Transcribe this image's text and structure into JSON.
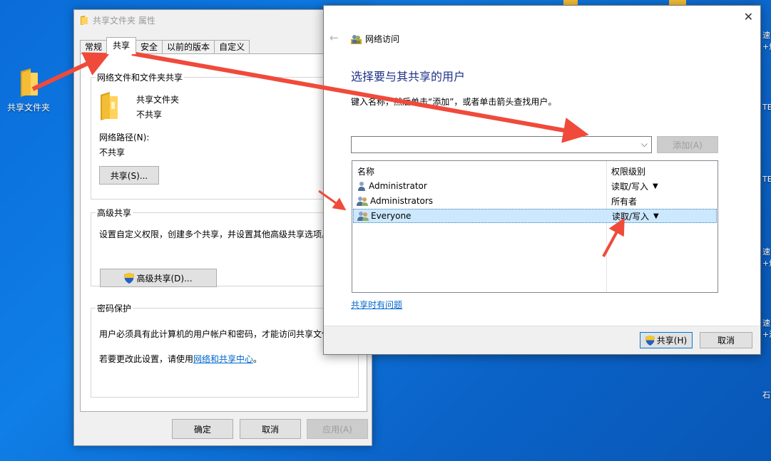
{
  "desktop": {
    "folder_label": "共享文件夹",
    "edge_texts": [
      "速",
      "+炒",
      "TE",
      "TE",
      "速",
      "+炒",
      "速",
      "+淡",
      "石"
    ]
  },
  "props_window": {
    "title": "共享文件夹 属性",
    "tabs": [
      "常规",
      "共享",
      "安全",
      "以前的版本",
      "自定义"
    ],
    "active_tab": "共享",
    "network_group": {
      "title": "网络文件和文件夹共享",
      "folder_name": "共享文件夹",
      "folder_status": "不共享",
      "path_label": "网络路径(N):",
      "path_value": "不共享",
      "share_button": "共享(S)..."
    },
    "advanced_group": {
      "title": "高级共享",
      "description": "设置自定义权限，创建多个共享，并设置其他高级共享选项。",
      "button": "高级共享(D)..."
    },
    "password_group": {
      "title": "密码保护",
      "text1": "用户必须具有此计算机的用户帐户和密码，才能访问共享文件",
      "text2_prefix": "若要更改此设置，请使用",
      "text2_link": "网络和共享中心",
      "text2_suffix": "。"
    },
    "buttons": {
      "ok": "确定",
      "cancel": "取消",
      "apply": "应用(A)"
    }
  },
  "network_dialog": {
    "title": "网络访问",
    "heading": "选择要与其共享的用户",
    "instruction": "键入名称，然后单击“添加”，或者单击箭头查找用户。",
    "combo_value": "",
    "add_button": "添加(A)",
    "columns": [
      "名称",
      "权限级别"
    ],
    "users": [
      {
        "name": "Administrator",
        "permission": "读取/写入",
        "has_dropdown": true,
        "icon": "user-icon"
      },
      {
        "name": "Administrators",
        "permission": "所有者",
        "has_dropdown": false,
        "icon": "group-icon"
      },
      {
        "name": "Everyone",
        "permission": "读取/写入",
        "has_dropdown": true,
        "icon": "group-icon",
        "selected": true
      }
    ],
    "help_link": "共享时有问题",
    "share_button": "共享(H)",
    "cancel_button": "取消"
  },
  "colors": {
    "accent_arrow": "#f04a3a",
    "heading_blue": "#1e3287",
    "link_blue": "#0066cc",
    "selection": "#cce8ff"
  }
}
